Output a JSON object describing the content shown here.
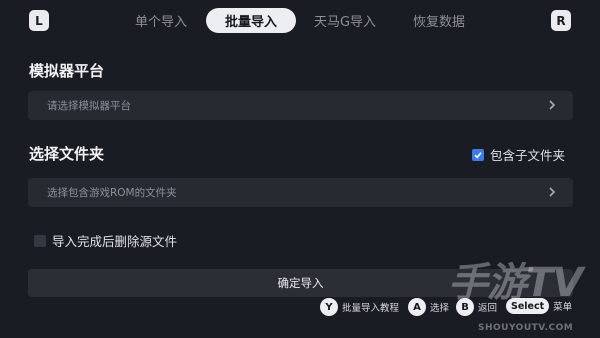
{
  "shoulders": {
    "left": "L",
    "right": "R"
  },
  "tabs": [
    {
      "label": "单个导入",
      "active": false
    },
    {
      "label": "批量导入",
      "active": true
    },
    {
      "label": "天马G导入",
      "active": false
    },
    {
      "label": "恢复数据",
      "active": false
    }
  ],
  "emulator": {
    "title": "模拟器平台",
    "placeholder": "请选择模拟器平台"
  },
  "folder": {
    "title": "选择文件夹",
    "include_subfolders_label": "包含子文件夹",
    "include_subfolders_checked": true,
    "placeholder": "选择包含游戏ROM的文件夹"
  },
  "delete_after_import": {
    "label": "导入完成后删除源文件",
    "checked": false
  },
  "confirm_label": "确定导入",
  "hints": [
    {
      "key": "Y",
      "label": "批量导入教程"
    },
    {
      "key": "A",
      "label": "选择"
    },
    {
      "key": "B",
      "label": "返回"
    },
    {
      "key": "Select",
      "label": "菜单"
    }
  ],
  "watermark": {
    "main": "手游TV",
    "url": "SHOUYOUTV.COM"
  },
  "colors": {
    "background": "#191c22",
    "panel": "#272a31",
    "accent": "#3f7be4",
    "active_tab": "#eceef1"
  }
}
